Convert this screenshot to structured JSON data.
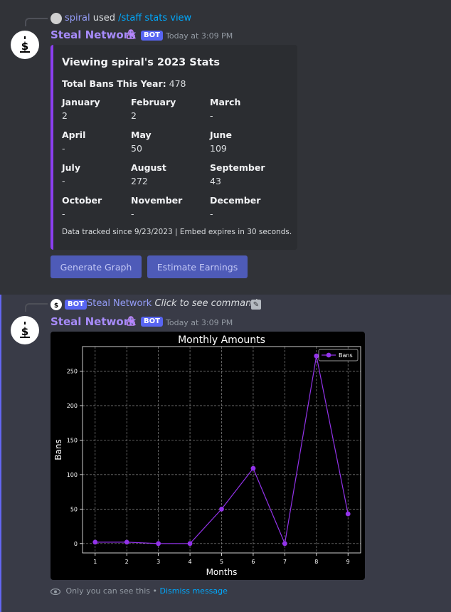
{
  "message1": {
    "reply": {
      "user": "spiral",
      "used": "used",
      "command": "/staff stats view"
    },
    "author": {
      "name": "Steal Network",
      "bot_tag": "BOT",
      "timestamp": "Today at 3:09 PM"
    },
    "embed": {
      "title": "Viewing spiral's 2023 Stats",
      "total_label": "Total Bans This Year:",
      "total_value": "478",
      "months": [
        {
          "name": "January",
          "value": "2"
        },
        {
          "name": "February",
          "value": "2"
        },
        {
          "name": "March",
          "value": "-"
        },
        {
          "name": "April",
          "value": "-"
        },
        {
          "name": "May",
          "value": "50"
        },
        {
          "name": "June",
          "value": "109"
        },
        {
          "name": "July",
          "value": "-"
        },
        {
          "name": "August",
          "value": "272"
        },
        {
          "name": "September",
          "value": "43"
        },
        {
          "name": "October",
          "value": "-"
        },
        {
          "name": "November",
          "value": "-"
        },
        {
          "name": "December",
          "value": "-"
        }
      ],
      "footer": "Data tracked since 9/23/2023 | Embed expires in 30 seconds.",
      "accent": "#8b3ef0"
    },
    "buttons": {
      "graph": "Generate Graph",
      "earnings": "Estimate Earnings"
    }
  },
  "message2": {
    "reply": {
      "bot_tag": "BOT",
      "user": "Steal Network",
      "hint": "Click to see command"
    },
    "author": {
      "name": "Steal Network",
      "bot_tag": "BOT",
      "timestamp": "Today at 3:09 PM"
    },
    "ephemeral": {
      "text": "Only you can see this •",
      "dismiss": "Dismiss message"
    }
  },
  "chart_data": {
    "type": "line",
    "title": "Monthly Amounts",
    "xlabel": "Months",
    "ylabel": "Bans",
    "x": [
      1,
      2,
      3,
      4,
      5,
      6,
      7,
      8,
      9
    ],
    "series": [
      {
        "name": "Bans",
        "values": [
          2,
          2,
          0,
          0,
          50,
          109,
          0,
          272,
          43
        ]
      }
    ],
    "xlim": [
      0.6,
      9.4
    ],
    "ylim": [
      -13.6,
      285.6
    ],
    "yticks": [
      0,
      50,
      100,
      150,
      200,
      250
    ],
    "grid": true,
    "legend": "top-right",
    "color": "#9333ea"
  }
}
